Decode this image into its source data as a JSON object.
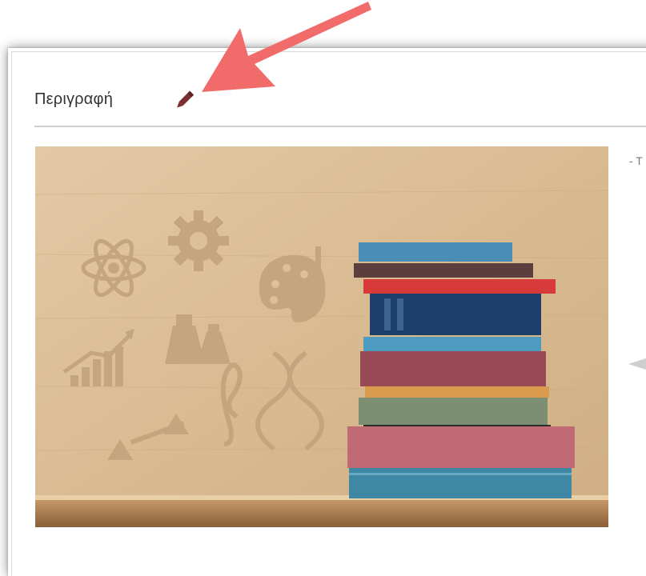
{
  "section": {
    "title": "Περιγραφή",
    "edit_icon": "pencil-icon",
    "side_text": "- T"
  },
  "annotation": {
    "arrow_color": "#f26b6b",
    "arrow_icon": "pointer-arrow"
  },
  "image": {
    "subject": "stacked-books-on-shelf",
    "icons": [
      "atom-icon",
      "gear-icon",
      "palette-icon",
      "chart-icon",
      "flask-icon",
      "dna-icon",
      "music-clef-icon",
      "scales-icon"
    ]
  },
  "colors": {
    "title_text": "#333333",
    "pencil": "#7a3030",
    "wood": "#dcc09a"
  }
}
